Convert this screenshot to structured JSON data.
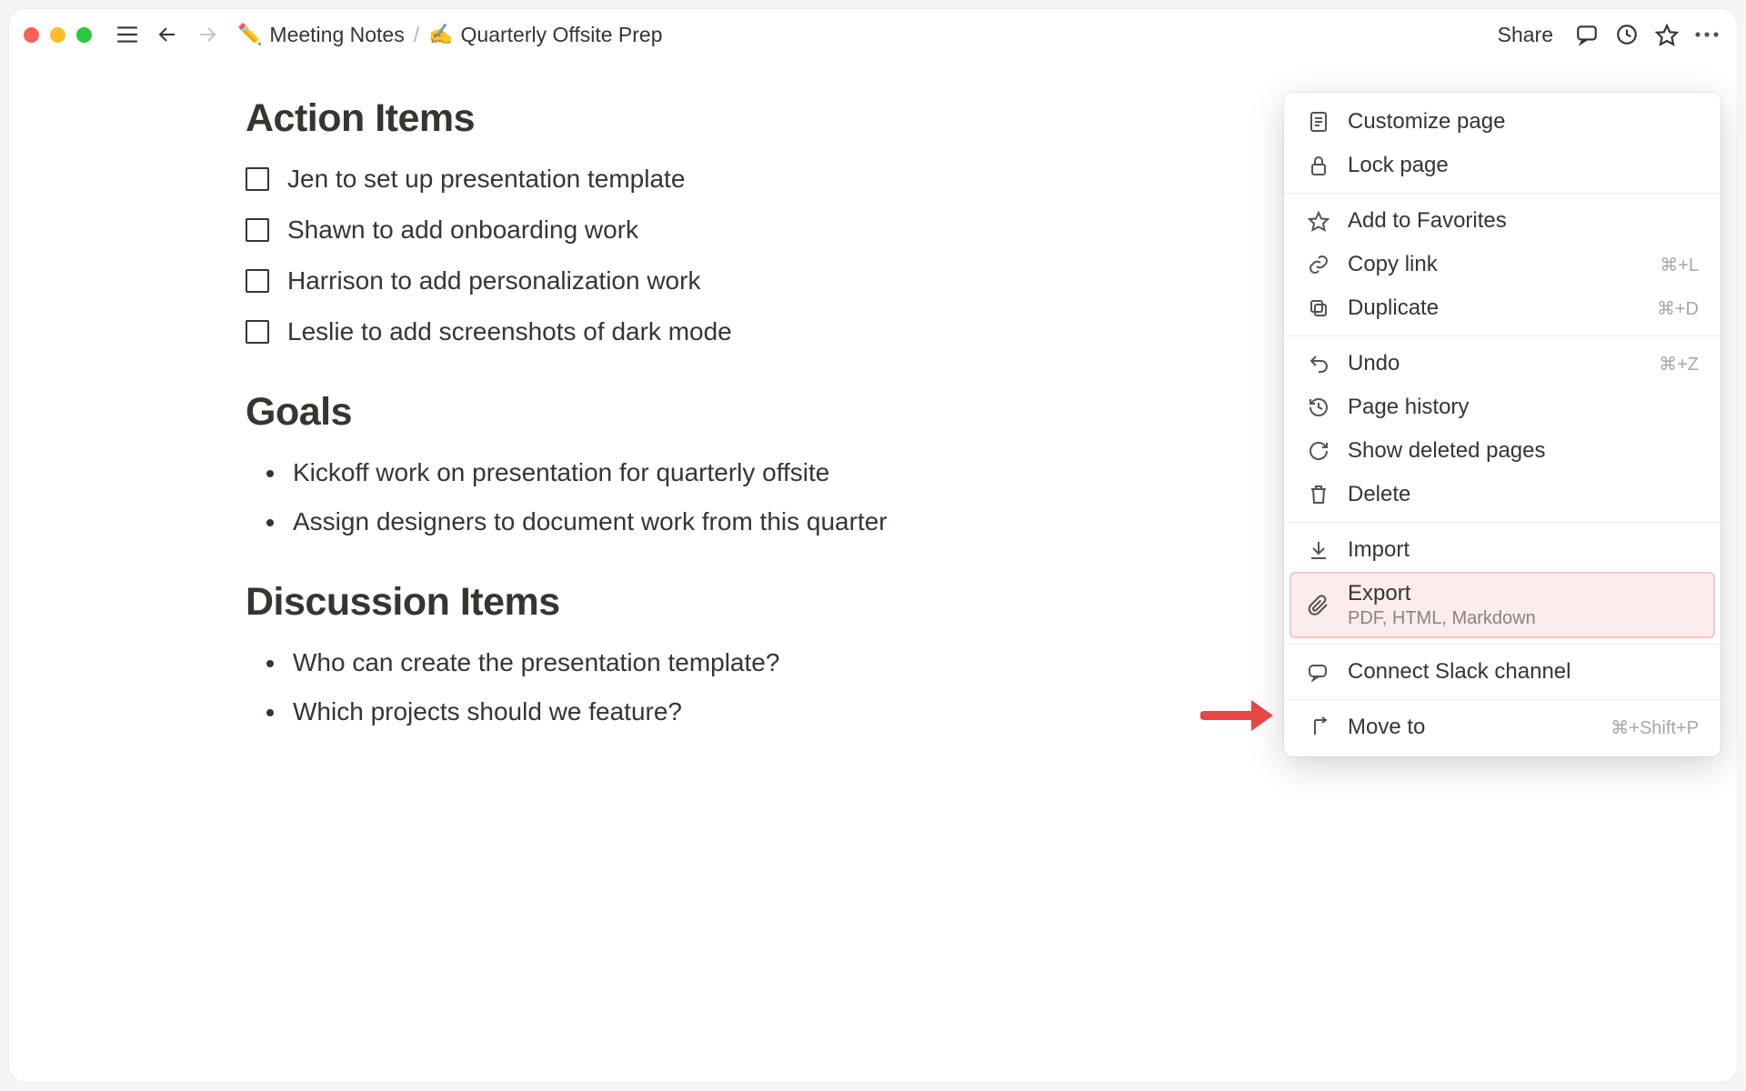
{
  "breadcrumb": {
    "parent_emoji": "✏️",
    "parent": "Meeting Notes",
    "sep": "/",
    "page_emoji": "✍️",
    "page": "Quarterly Offsite Prep"
  },
  "topbar": {
    "share": "Share"
  },
  "sections": {
    "action_items": {
      "title": "Action Items",
      "items": [
        "Jen to set up presentation template",
        "Shawn to add onboarding work",
        "Harrison to add personalization work",
        "Leslie to add screenshots of dark mode"
      ]
    },
    "goals": {
      "title": "Goals",
      "items": [
        "Kickoff work on presentation for quarterly offsite",
        "Assign designers to document work from this quarter"
      ]
    },
    "discussion": {
      "title": "Discussion Items",
      "items": [
        "Who can create the presentation template?",
        "Which projects should we feature?"
      ]
    }
  },
  "menu": {
    "customize": "Customize page",
    "lock": "Lock page",
    "favorites": "Add to Favorites",
    "copy_link": {
      "label": "Copy link",
      "shortcut": "⌘+L"
    },
    "duplicate": {
      "label": "Duplicate",
      "shortcut": "⌘+D"
    },
    "undo": {
      "label": "Undo",
      "shortcut": "⌘+Z"
    },
    "page_history": "Page history",
    "show_deleted": "Show deleted pages",
    "delete": "Delete",
    "import": "Import",
    "export": {
      "label": "Export",
      "sub": "PDF, HTML, Markdown"
    },
    "connect_slack": "Connect Slack channel",
    "move_to": {
      "label": "Move to",
      "shortcut": "⌘+Shift+P"
    }
  }
}
